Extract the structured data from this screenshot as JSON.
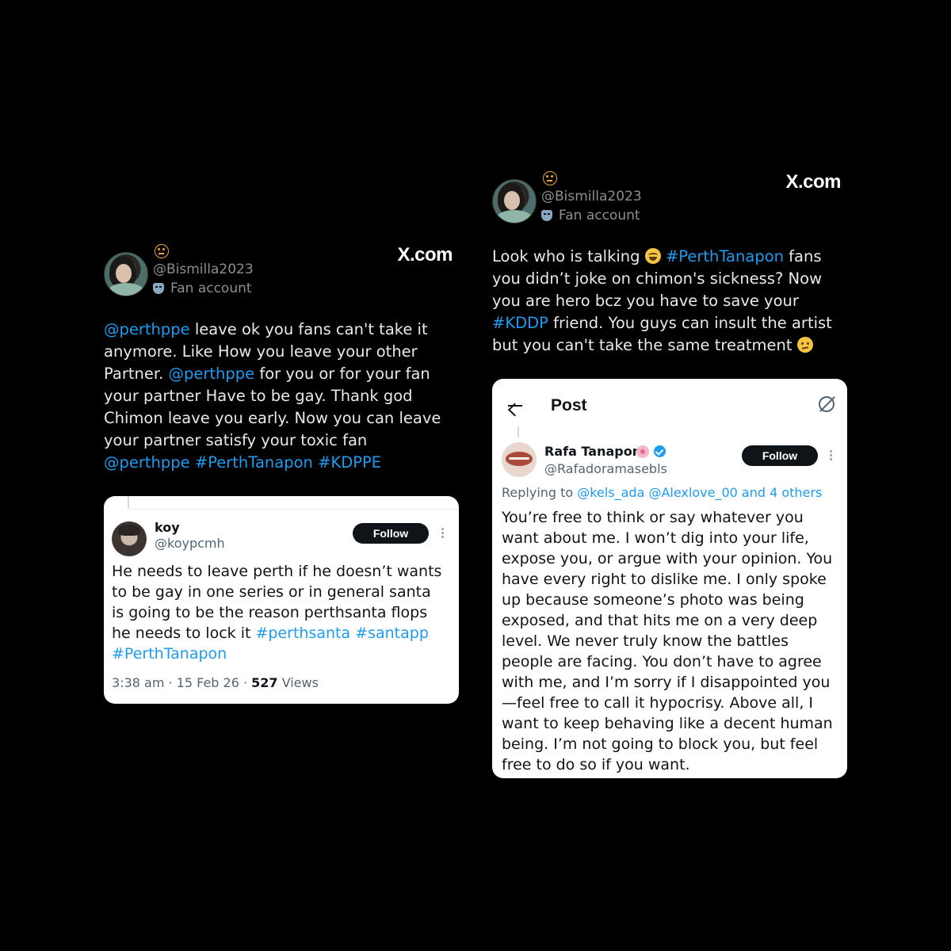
{
  "site_label": "X.com",
  "left_tweet": {
    "handle": "@Bismilla2023",
    "badge": "Fan account",
    "text_parts": [
      {
        "t": "@perthppe",
        "link": true
      },
      {
        "t": " leave ok you fans can't take it anymore. Like How you leave your other Partner. ",
        "link": false
      },
      {
        "t": "@perthppe",
        "link": true
      },
      {
        "t": " for you or for your fan your partner Have to be gay. Thank god Chimon leave you early. Now you can leave your partner satisfy your toxic fan ",
        "link": false
      },
      {
        "t": "@perthppe",
        "link": true
      },
      {
        "t": " ",
        "link": false
      },
      {
        "t": "#PerthTanapon",
        "link": true
      },
      {
        "t": " ",
        "link": false
      },
      {
        "t": "#KDPPE",
        "link": true
      }
    ],
    "embedded": {
      "name": "koy",
      "handle": "@koypcmh",
      "follow_label": "Follow",
      "text_parts": [
        {
          "t": "He needs to leave perth if he doesn’t wants to be gay in one series or in general santa is going to be the reason perthsanta flops he needs to lock it  ",
          "link": false
        },
        {
          "t": "#perthsanta",
          "link": true
        },
        {
          "t": " ",
          "link": false
        },
        {
          "t": "#santapp",
          "link": true
        },
        {
          "t": " ",
          "link": false
        },
        {
          "t": "#PerthTanapon",
          "link": true
        }
      ],
      "meta_time": "3:38 am · 15 Feb 26 · ",
      "meta_views_count": "527",
      "meta_views_label": " Views"
    }
  },
  "right_tweet": {
    "handle": "@Bismilla2023",
    "badge": "Fan account",
    "text_parts": [
      {
        "t": "Look who is talking ",
        "link": false
      },
      {
        "emoji": "laugh"
      },
      {
        "t": " ",
        "link": false
      },
      {
        "t": "#PerthTanapon",
        "link": true
      },
      {
        "t": " fans you didn’t joke on chimon's sickness? Now you are hero bcz you have to save your ",
        "link": false
      },
      {
        "t": "#KDDP",
        "link": true
      },
      {
        "t": " friend. You guys can insult the artist but you can't take the same treatment ",
        "link": false
      },
      {
        "emoji": "smirk"
      }
    ],
    "embedded": {
      "header_title": "Post",
      "name": "Rafa Tanapon",
      "handle": "@Rafadoramasebls",
      "follow_label": "Follow",
      "replying_prefix": "Replying to ",
      "replying_to": "@kels_ada @Alexlove_00 and 4 others",
      "text": "You’re free to think or say whatever you want about me. I won’t dig into your life, expose you, or argue with your opinion. You have every right to dislike me. I only spoke up because someone’s photo was being exposed, and that hits me on a very deep level. We never truly know the battles people are facing. You don’t have to agree with me, and I’m sorry if I disappointed you—feel free to call it hypocrisy. Above all, I want to keep behaving like a decent human being. I’m not going to block you, but feel free to do so if you want."
    }
  },
  "colors": {
    "background": "#000000",
    "link": "#1d9bf0",
    "text_light": "#e7e9ea",
    "muted": "#8b8f93"
  }
}
